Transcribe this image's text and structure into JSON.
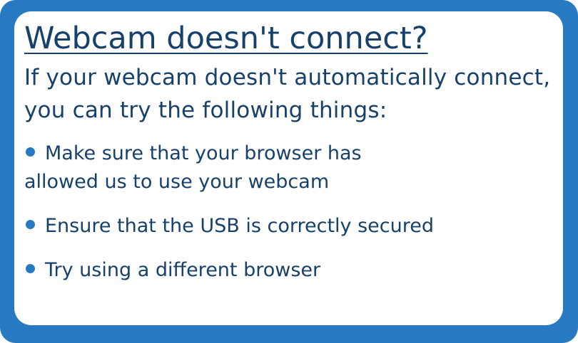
{
  "dialog": {
    "title": "Webcam doesn't connect?",
    "intro": "If your webcam doesn't automatically connect, you can try the following things:",
    "tips": [
      "Make sure that your browser has allowed us to use your webcam",
      "Ensure that the USB is correctly secured",
      "Try using a different browser"
    ]
  },
  "colors": {
    "frame": "#2779c2",
    "text": "#17406a",
    "bullet": "#2779c2"
  }
}
